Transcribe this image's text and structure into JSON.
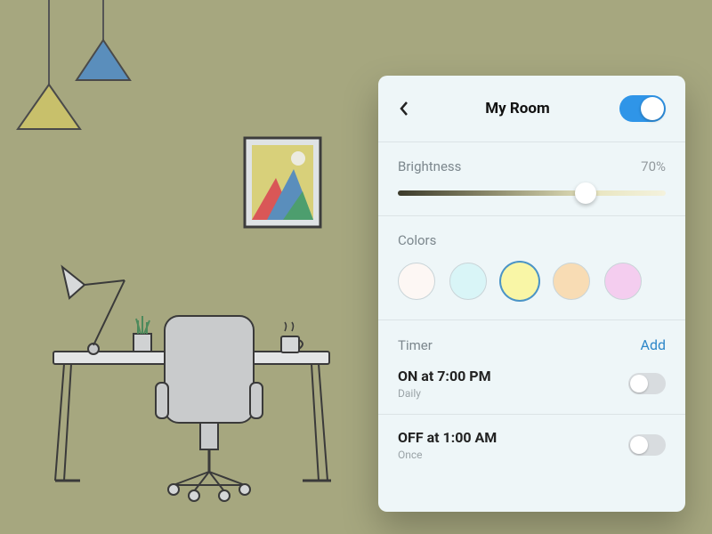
{
  "header": {
    "title": "My Room",
    "main_toggle_on": true
  },
  "brightness": {
    "label": "Brightness",
    "value_text": "70%",
    "percent": 70
  },
  "colors": {
    "label": "Colors",
    "options": [
      {
        "name": "white",
        "hex": "#fdf7f4",
        "selected": false
      },
      {
        "name": "cyan",
        "hex": "#d9f5f7",
        "selected": false
      },
      {
        "name": "yellow",
        "hex": "#f9f6a6",
        "selected": true
      },
      {
        "name": "orange",
        "hex": "#f8dcb4",
        "selected": false
      },
      {
        "name": "pink",
        "hex": "#f4cdef",
        "selected": false
      }
    ]
  },
  "timer": {
    "label": "Timer",
    "add_label": "Add",
    "items": [
      {
        "title": "ON at 7:00 PM",
        "sub": "Daily",
        "enabled": false
      },
      {
        "title": "OFF at 1:00 AM",
        "sub": "Once",
        "enabled": false
      }
    ]
  },
  "scene": {
    "lamp_colors": {
      "left_shade": "#c8c06b",
      "right_shade": "#5a8ebc"
    },
    "picture_colors": {
      "sky": "#d8d07a",
      "sun": "#ecebe0",
      "hill1": "#d95757",
      "hill2": "#4d9e6e",
      "hill3": "#5a8ebc"
    }
  }
}
